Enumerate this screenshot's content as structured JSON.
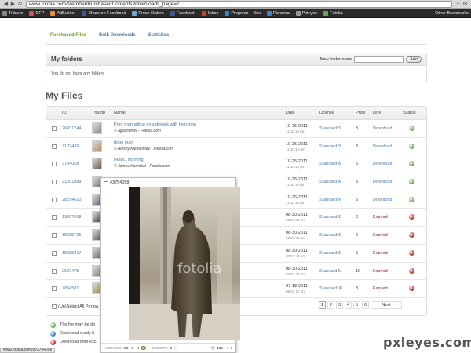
{
  "browser": {
    "url": "www.fotolia.com/Member/PurchasedContents?downloads_page=1",
    "bookmarks": [
      {
        "label": "Tribune",
        "color": "#888888"
      },
      {
        "label": "DFP",
        "color": "#d9534f"
      },
      {
        "label": "AdBuilder",
        "color": "#e69138"
      },
      {
        "label": "Share on Facebook",
        "color": "#3b5998"
      },
      {
        "label": "Press Orders",
        "color": "#6fa8dc"
      },
      {
        "label": "Facebook",
        "color": "#3b5998"
      },
      {
        "label": "Inbox",
        "color": "#cc4125"
      },
      {
        "label": "Progress – Box",
        "color": "#3d85c6"
      },
      {
        "label": "Pandora",
        "color": "#3d85c6"
      },
      {
        "label": "Pxleyes",
        "color": "#999999"
      },
      {
        "label": "Fotolia",
        "color": "#6aa84f"
      }
    ],
    "other_bookmarks": "Other Bookmarks",
    "status_url": "www.fotolia.com/id/3754058"
  },
  "tabs": [
    {
      "label": "Purchased Files",
      "active": true
    },
    {
      "label": "Bulk Downloads",
      "active": false
    },
    {
      "label": "Statistics",
      "active": false
    }
  ],
  "folders": {
    "title": "My folders",
    "new_folder_label": "New folder name",
    "add_button": "Add",
    "empty_text": "You do not have any folders"
  },
  "myfiles_title": "My Files",
  "table": {
    "headers": {
      "id": "ID",
      "thumb": "Thumb",
      "name": "Name",
      "date": "Date",
      "license": "License",
      "price": "Price",
      "link": "Link",
      "status": "Status"
    },
    "rows": [
      {
        "id": "26831244",
        "name": "Poor man sitting on sidewalk with help sign",
        "author": "© agsandrew - Fotolia.com",
        "date": "10-25-2011",
        "time": "11:10:16 pm",
        "license": "Standard S",
        "price": "3",
        "link": "Download",
        "status": "#6ab04c",
        "thumb": "#8a8a8a"
      },
      {
        "id": "7132439",
        "name": "hobo man",
        "author": "© Alexey Klementiev - Fotolia.com",
        "date": "10-25-2011",
        "time": "11:10:16 pm",
        "license": "Standard S",
        "price": "3",
        "link": "Download",
        "status": "#6ab04c",
        "thumb": "#b58b5c"
      },
      {
        "id": "3754058",
        "name": "HOBO morning",
        "author": "© James Hannibal - Fotolia.com",
        "date": "10-25-2011",
        "time": "11:10:16 pm",
        "license": "Standard M",
        "price": "5",
        "link": "Download",
        "status": "#6ab04c",
        "thumb": "#6b5a45"
      },
      {
        "id": "21201889",
        "name": "",
        "author": "",
        "date": "10-25-2011",
        "time": "11:10:16 pm",
        "license": "Standard M",
        "price": "5",
        "link": "Download",
        "status": "#6ab04c",
        "thumb": "#7a7a7a"
      },
      {
        "id": "28254620",
        "name": "",
        "author": "",
        "date": "10-25-2011",
        "time": "11:10:16 pm",
        "license": "Standard M",
        "price": "5",
        "link": "Download",
        "status": "#6ab04c",
        "thumb": "#5d6a78"
      },
      {
        "id": "13897608",
        "name": "",
        "author": "",
        "date": "08-30-2011",
        "time": "03:57:48 pm",
        "license": "Standard S",
        "price": "6",
        "link": "Expired",
        "status": "#c0392b",
        "thumb": "#444444"
      },
      {
        "id": "15585725",
        "name": "",
        "author": "",
        "date": "08-30-2011",
        "time": "03:57:48 pm",
        "license": "Standard S",
        "price": "6",
        "link": "Expired",
        "status": "#c0392b",
        "thumb": "#555555"
      },
      {
        "id": "15585817",
        "name": "",
        "author": "",
        "date": "08-30-2011",
        "time": "03:57:48 pm",
        "license": "Standard S",
        "price": "6",
        "link": "Expired",
        "status": "#c0392b",
        "thumb": "#666666"
      },
      {
        "id": "2627475",
        "name": "",
        "author": "",
        "date": "08-30-2011",
        "time": "03:57:48 pm",
        "license": "Standard M",
        "price": "10",
        "link": "Expired",
        "status": "#c0392b",
        "thumb": "#7d8a6b"
      },
      {
        "id": "7854581",
        "name": "",
        "author": "",
        "date": "07-18-2011",
        "time": "08:47:17 pm",
        "license": "Standard XL",
        "price": "8",
        "link": "Expired",
        "status": "#c0392b",
        "thumb": "#9c8a3a"
      }
    ],
    "select_all": "(Un)Select All Per pa",
    "pages": [
      "1",
      "2",
      "3",
      "4",
      "5",
      "6"
    ],
    "next": "Next"
  },
  "legend": [
    {
      "text": "The file may be do",
      "color": "#6ab04c"
    },
    {
      "text": "Download ready b",
      "color": "#3d85c6"
    },
    {
      "text": "Download time exc",
      "color": "#c0392b"
    }
  ],
  "popup": {
    "title": "#3754058",
    "licenses_label": "LICENSES:",
    "licenses_value": "XS - L - X",
    "licenses_badge": "5",
    "credits_label": "CREDITS:",
    "credits_value": "1",
    "views": "136",
    "downloads": "4",
    "watermark": "fotolia"
  },
  "site_watermark": "pxleyes.com"
}
